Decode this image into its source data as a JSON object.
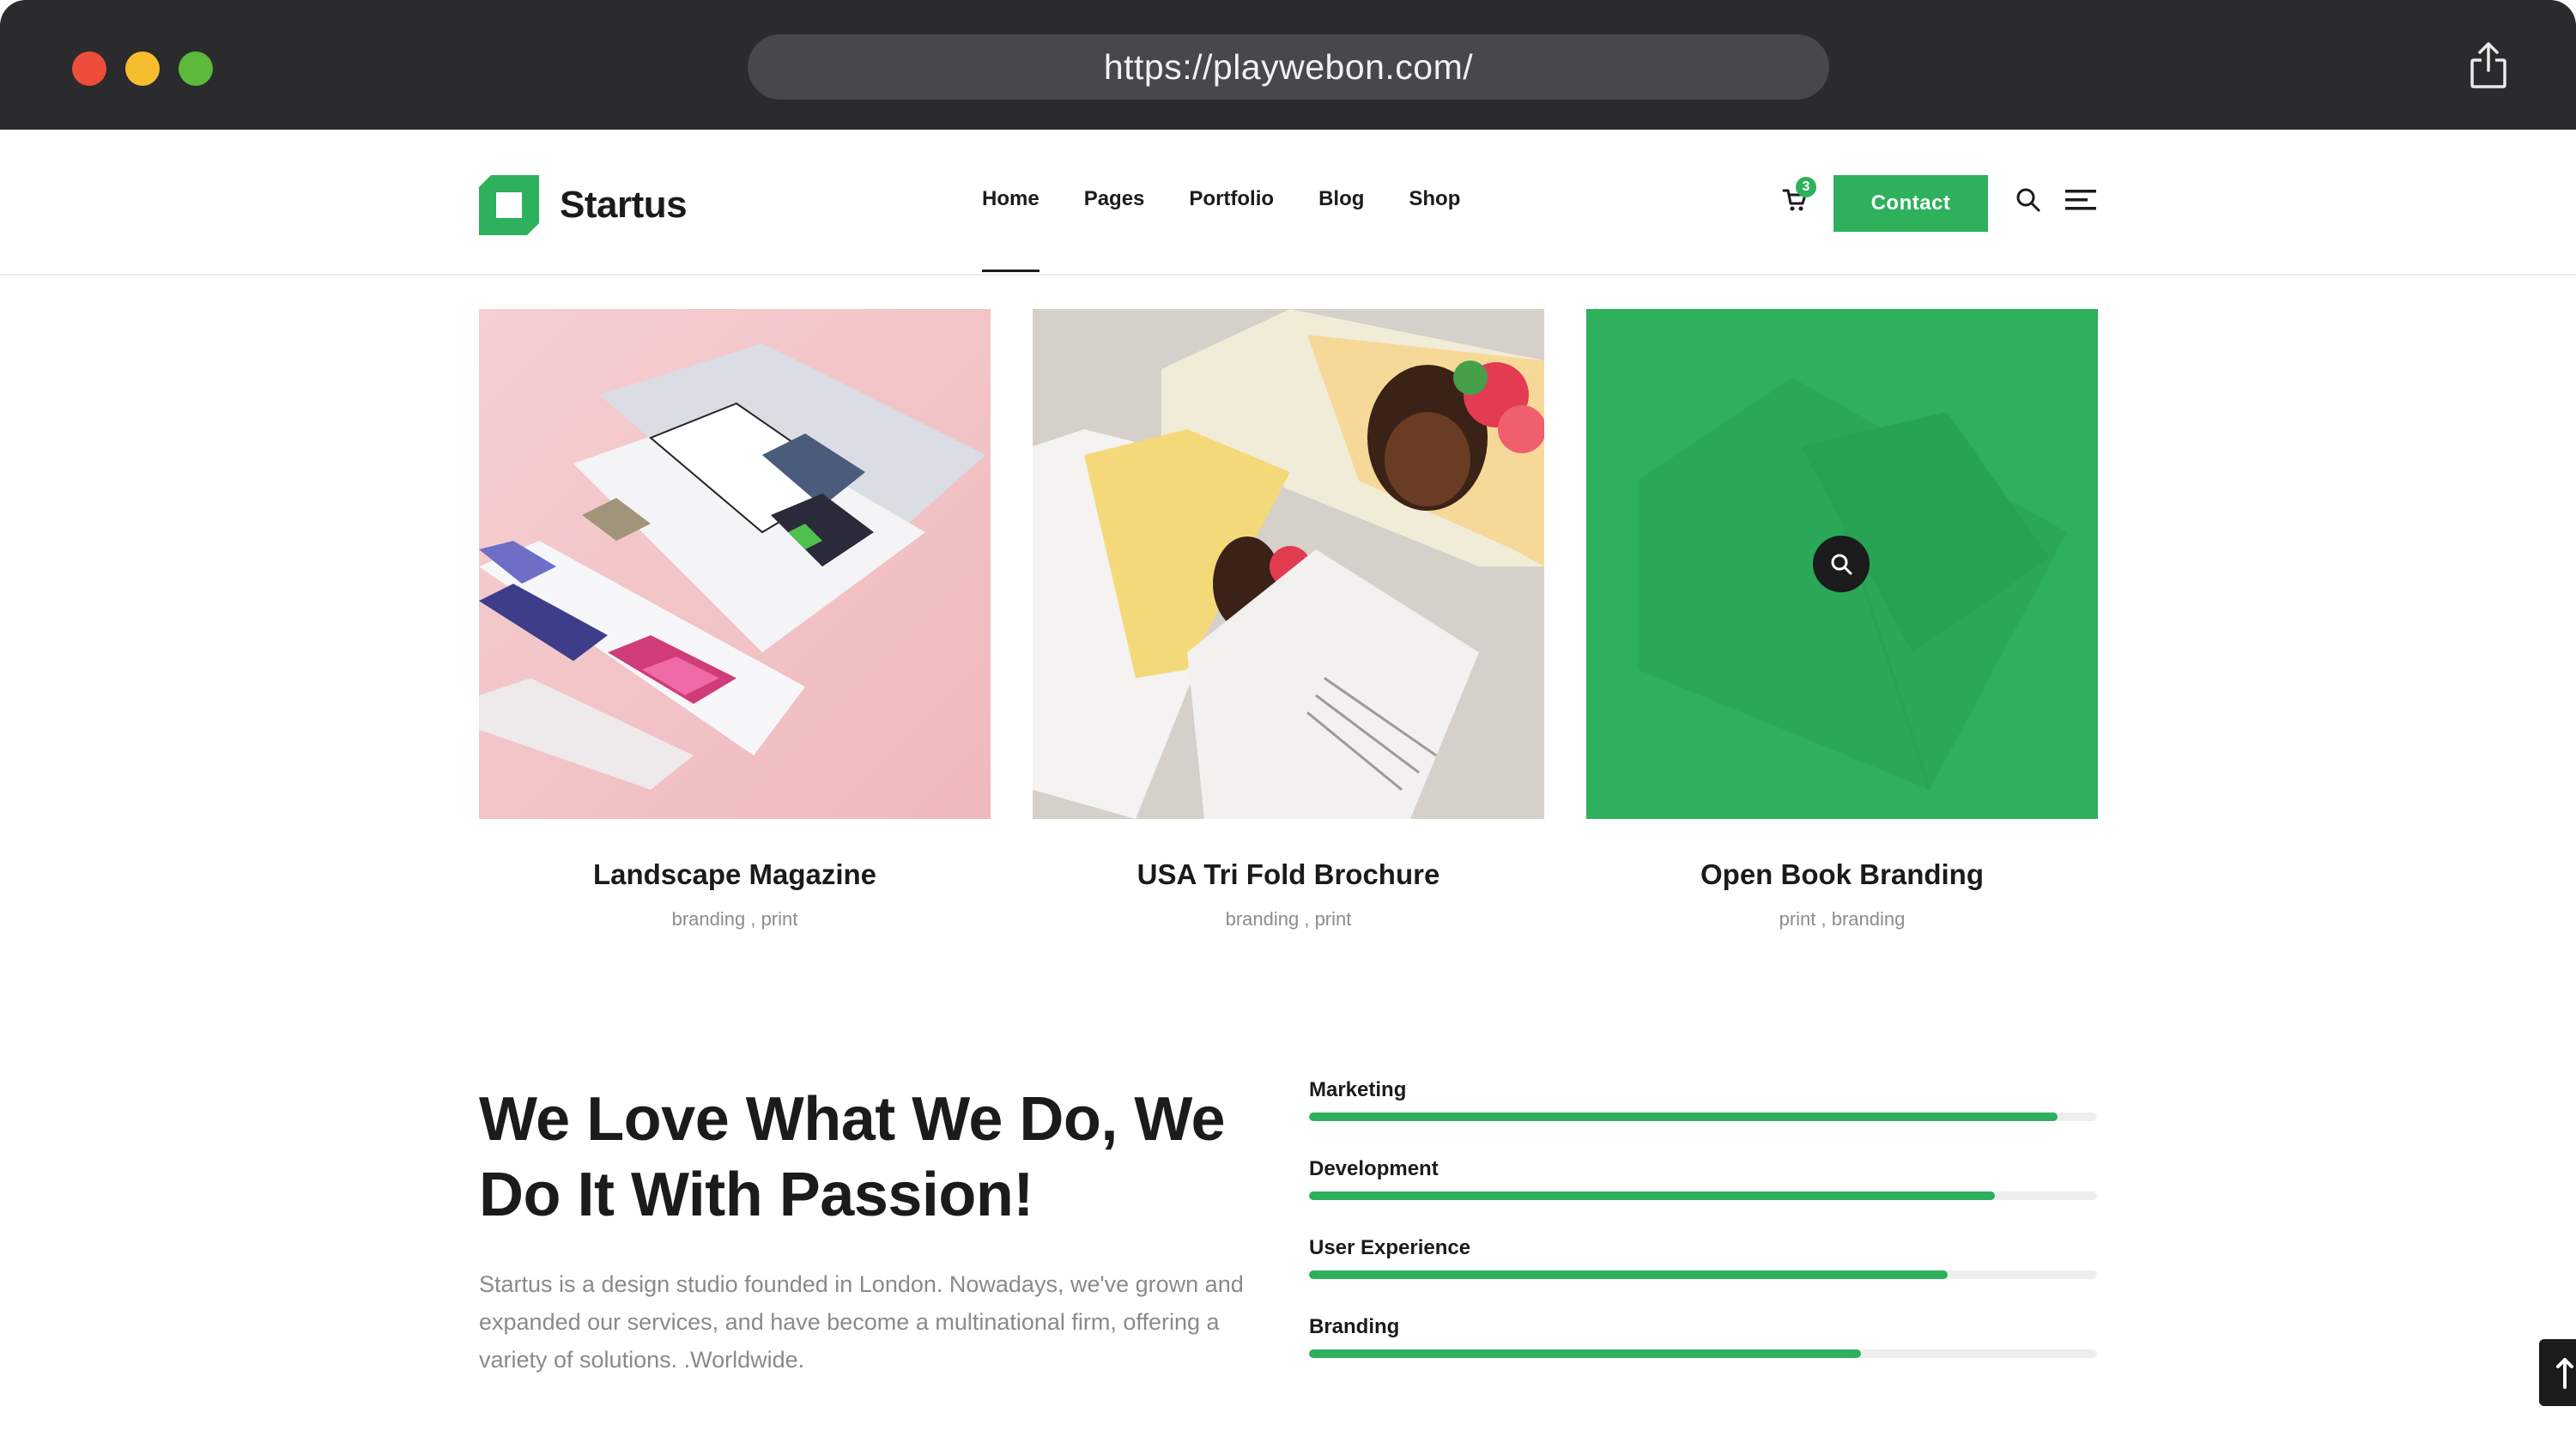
{
  "browser": {
    "url": "https://playwebon.com/",
    "share_icon": "share-icon"
  },
  "header": {
    "logo_text": "Startus",
    "nav": [
      {
        "label": "Home",
        "active": true
      },
      {
        "label": "Pages"
      },
      {
        "label": "Portfolio"
      },
      {
        "label": "Blog"
      },
      {
        "label": "Shop"
      }
    ],
    "cart_count": "3",
    "contact_label": "Contact",
    "icons": [
      "cart-icon",
      "search-icon",
      "menu-icon"
    ]
  },
  "portfolio": [
    {
      "title": "Landscape Magazine",
      "tags": "branding , print"
    },
    {
      "title": "USA Tri Fold Brochure",
      "tags": "branding , print"
    },
    {
      "title": "Open Book Branding",
      "tags": "print , branding"
    }
  ],
  "about": {
    "headline": "We Love What We Do, We Do It With Passion!",
    "paragraph": "Startus is a design studio founded in London. Nowadays, we've grown and expanded our services, and have become a multinational firm, offering a variety of solutions. .Worldwide."
  },
  "skills": [
    {
      "label": "Marketing",
      "percent": 95
    },
    {
      "label": "Development",
      "percent": 87
    },
    {
      "label": "User Experience",
      "percent": 81
    },
    {
      "label": "Branding",
      "percent": 70
    }
  ],
  "colors": {
    "accent": "#2eb05c",
    "dark": "#1b1b1b",
    "chrome": "#2b2b2d"
  }
}
